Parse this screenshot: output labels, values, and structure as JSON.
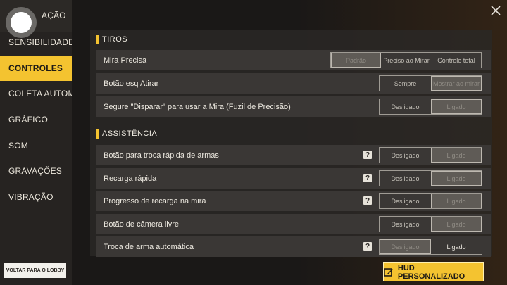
{
  "sidebar": {
    "items": [
      {
        "label": "AÇÃO"
      },
      {
        "label": "SENSIBILIDADE"
      },
      {
        "label": "CONTROLES"
      },
      {
        "label": "COLETA AUTOMÁ"
      },
      {
        "label": "GRÁFICO"
      },
      {
        "label": "SOM"
      },
      {
        "label": "GRAVAÇÕES"
      },
      {
        "label": "VIBRAÇÃO"
      }
    ],
    "active_index": 2,
    "lobby_label": "VOLTAR PARA O LOBBY"
  },
  "sections": {
    "tiros": {
      "title": "TIROS",
      "rows": [
        {
          "label": "Mira Precisa",
          "options": [
            "Padrão",
            "Preciso ao Mirar",
            "Controle total"
          ],
          "selected": 0
        },
        {
          "label": "Botão esq Atirar",
          "options": [
            "Sempre",
            "Mostrar ao mirar"
          ],
          "selected": 1
        },
        {
          "label": "Segure \"Disparar\" para usar a Mira (Fuzil de Precisão)",
          "options": [
            "Desligado",
            "Ligado"
          ],
          "selected": 1
        }
      ]
    },
    "assistencia": {
      "title": "ASSISTÊNCIA",
      "rows": [
        {
          "label": "Botão para troca rápida de armas",
          "options": [
            "Desligado",
            "Ligado"
          ],
          "selected": 1,
          "help": "?"
        },
        {
          "label": "Recarga rápida",
          "options": [
            "Desligado",
            "Ligado"
          ],
          "selected": 1,
          "help": "?"
        },
        {
          "label": "Progresso de recarga na mira",
          "options": [
            "Desligado",
            "Ligado"
          ],
          "selected": 1,
          "help": "?"
        },
        {
          "label": "Botão de câmera livre",
          "options": [
            "Desligado",
            "Ligado"
          ],
          "selected": 1
        },
        {
          "label": "Troca de arma automática",
          "options": [
            "Desligado",
            "Ligado"
          ],
          "selected": 0,
          "help": "?"
        }
      ]
    }
  },
  "hud_button": {
    "label": "HUD PERSONALIZADO"
  },
  "colors": {
    "accent": "#f4c330",
    "panel": "#3a3735",
    "selected_option": "#5f5b56"
  },
  "icons": {
    "close": "close-icon",
    "hud": "edit-icon",
    "record": "record-icon",
    "help": "help-icon"
  }
}
